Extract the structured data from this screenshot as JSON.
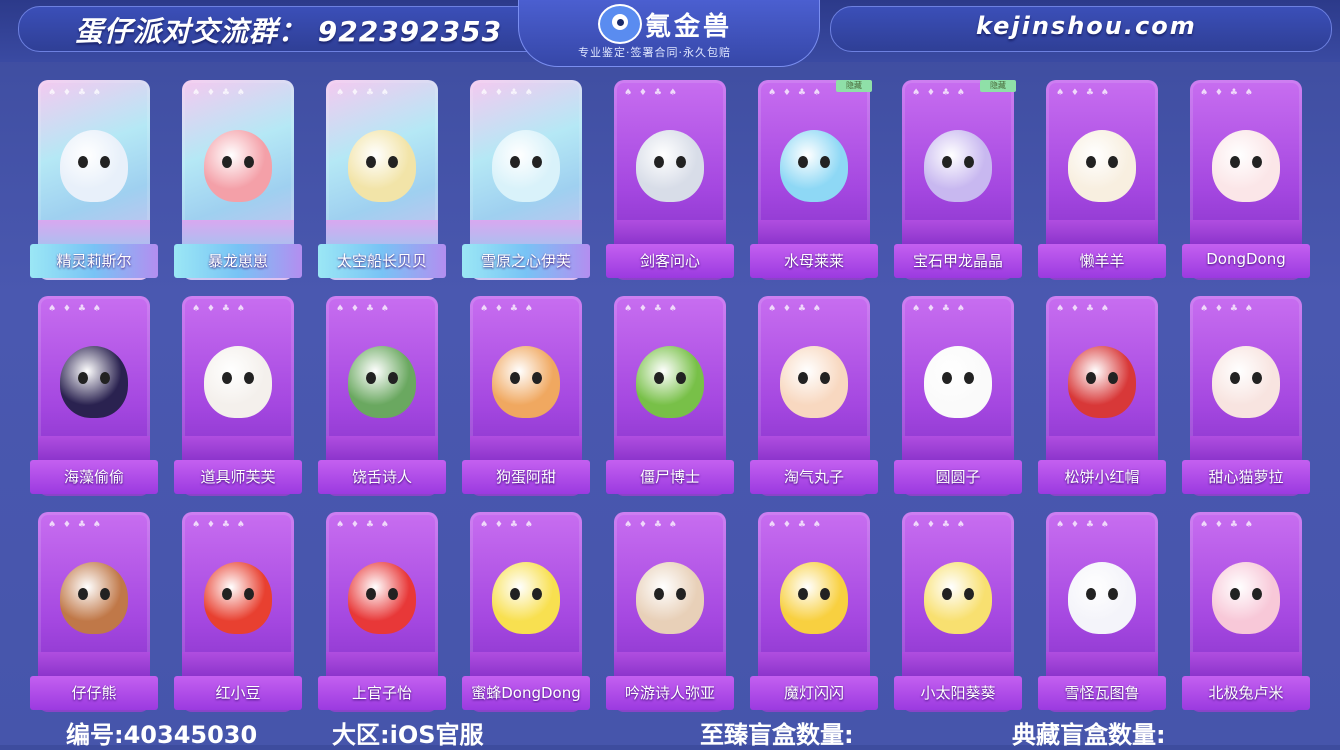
{
  "header": {
    "group_text": "蛋仔派对交流群：  922392353",
    "site": "kejinshou.com",
    "logo_title": "氪金兽",
    "logo_sub": "专业鉴定·签署合同·永久包赔"
  },
  "badge_text": "隐藏",
  "cards": [
    {
      "name": "精灵莉斯尔",
      "style": "holo",
      "color": "#e8f0fa"
    },
    {
      "name": "暴龙崽崽",
      "style": "holo",
      "color": "#f4a0a8"
    },
    {
      "name": "太空船长贝贝",
      "style": "holo",
      "color": "#f2e4a8"
    },
    {
      "name": "雪原之心伊芙",
      "style": "holo",
      "color": "#d9f2fa"
    },
    {
      "name": "剑客问心",
      "style": "purple",
      "color": "#d8dde8"
    },
    {
      "name": "水母莱莱",
      "style": "purple",
      "color": "#8ed8f5",
      "badge": true
    },
    {
      "name": "宝石甲龙晶晶",
      "style": "purple",
      "color": "#c8b8f0",
      "badge": true
    },
    {
      "name": "懒羊羊",
      "style": "purple",
      "color": "#f8efe0"
    },
    {
      "name": "DongDong",
      "style": "purple",
      "color": "#fbe6e8"
    },
    {
      "name": "海藻偷偷",
      "style": "purple",
      "color": "#2a2250"
    },
    {
      "name": "道具师芙芙",
      "style": "purple",
      "color": "#f4f0ec"
    },
    {
      "name": "饶舌诗人",
      "style": "purple",
      "color": "#6aa860"
    },
    {
      "name": "狗蛋阿甜",
      "style": "purple",
      "color": "#f0a860"
    },
    {
      "name": "僵尸博士",
      "style": "purple",
      "color": "#78c048"
    },
    {
      "name": "淘气丸子",
      "style": "purple",
      "color": "#f8d8c0"
    },
    {
      "name": "圆圆子",
      "style": "purple",
      "color": "#fafafa"
    },
    {
      "name": "松饼小红帽",
      "style": "purple",
      "color": "#d83838"
    },
    {
      "name": "甜心猫萝拉",
      "style": "purple",
      "color": "#f8e4e0"
    },
    {
      "name": "仔仔熊",
      "style": "purple",
      "color": "#c07848"
    },
    {
      "name": "红小豆",
      "style": "purple",
      "color": "#e84030"
    },
    {
      "name": "上官子怡",
      "style": "purple",
      "color": "#e83838"
    },
    {
      "name": "蜜蜂DongDong",
      "style": "purple",
      "color": "#f8e050"
    },
    {
      "name": "吟游诗人弥亚",
      "style": "purple",
      "color": "#e8d0b8"
    },
    {
      "name": "魔灯闪闪",
      "style": "purple",
      "color": "#f8d040"
    },
    {
      "name": "小太阳葵葵",
      "style": "purple",
      "color": "#f8e070"
    },
    {
      "name": "雪怪瓦图鲁",
      "style": "purple",
      "color": "#f4f4fa"
    },
    {
      "name": "北极兔卢米",
      "style": "purple",
      "color": "#f8c8d8"
    }
  ],
  "footer": {
    "id_text": "编号:40345030",
    "region_text": "大区:iOS官服",
    "supreme_text": "至臻盲盒数量:",
    "collection_text": "典藏盲盒数量:"
  }
}
